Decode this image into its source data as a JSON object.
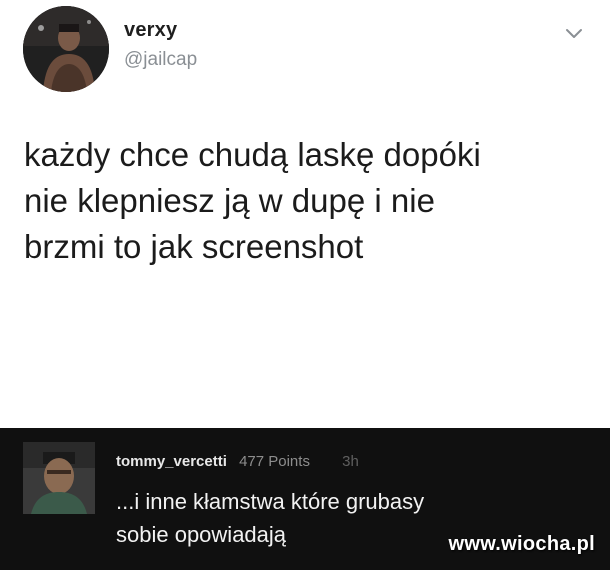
{
  "tweet": {
    "display_name": "verxy",
    "handle": "@jailcap",
    "text": "każdy chce chudą laskę dopóki\nnie klepniesz ją w dupę i nie\nbrzmi to jak screenshot",
    "avatar_icon": "user-avatar",
    "menu_icon": "chevron-down-icon"
  },
  "comment": {
    "username": "tommy_vercetti",
    "points": "477 Points",
    "time": "3h",
    "text": "...i inne kłamstwa które grubasy\nsobie opowiadają",
    "avatar_icon": "user-avatar"
  },
  "watermark": "www.wiocha.pl",
  "colors": {
    "tweet_bg": "#ffffff",
    "comment_bg": "#101010",
    "handle": "#8a8f94"
  }
}
